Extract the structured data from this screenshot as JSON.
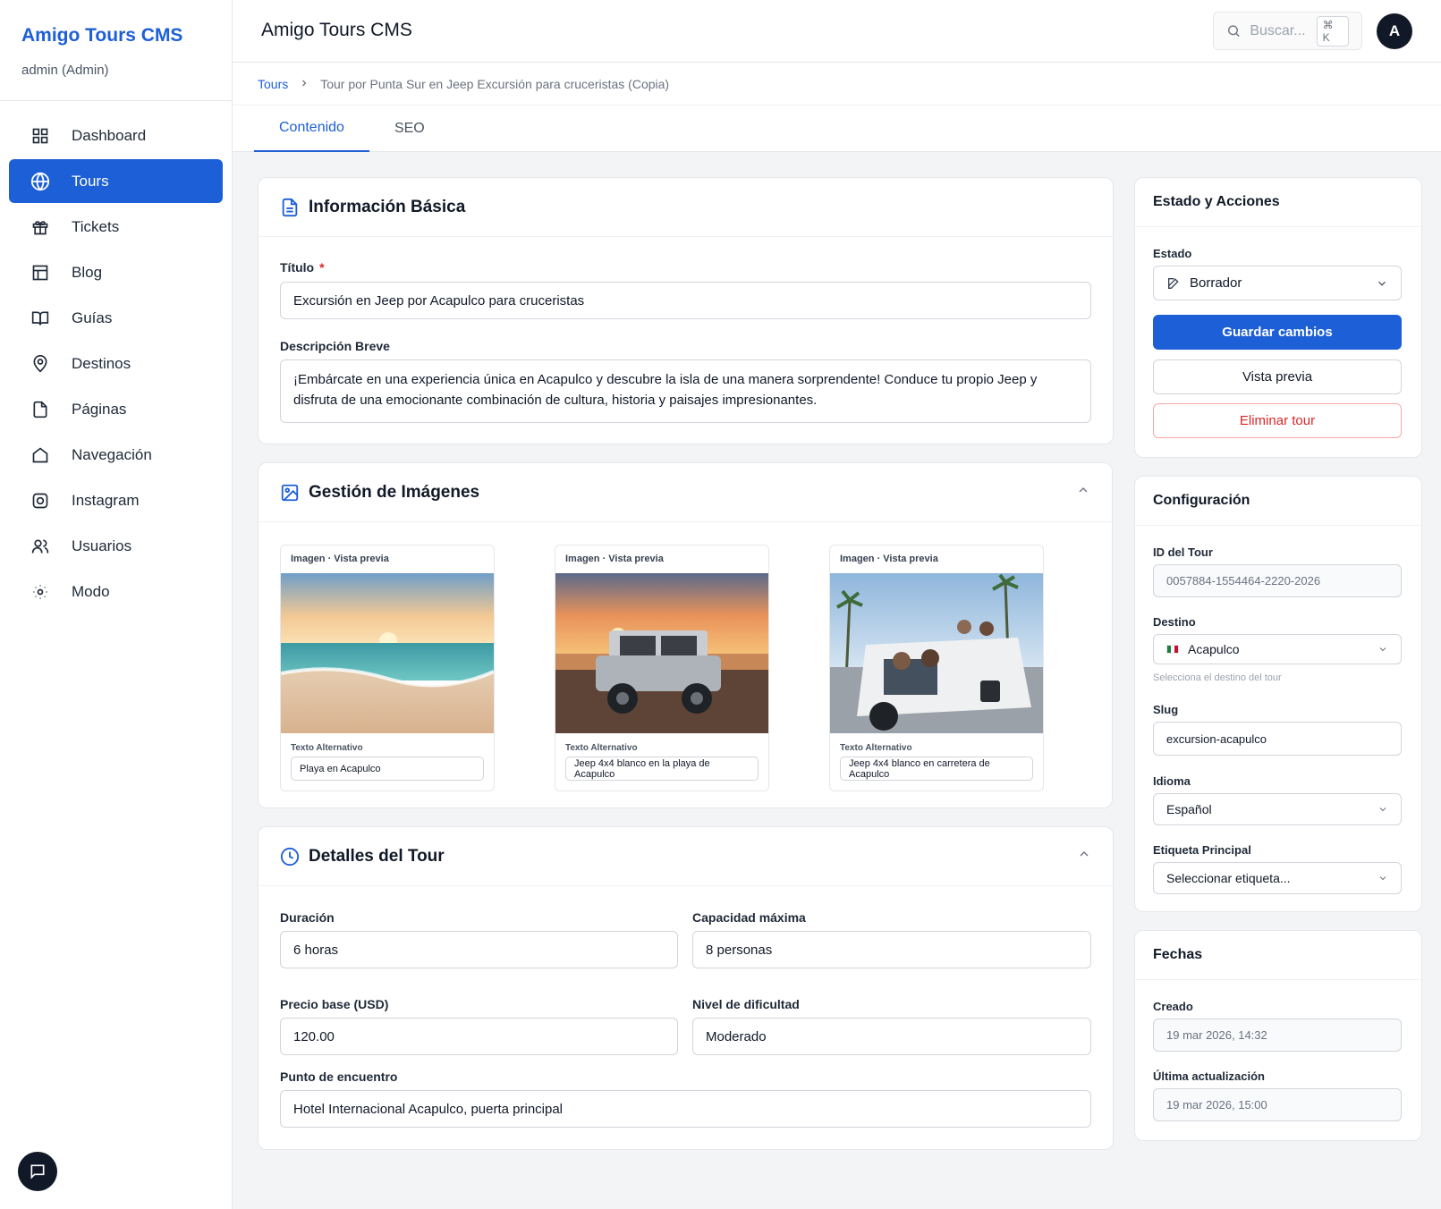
{
  "sidebar": {
    "brand": "Amigo Tours CMS",
    "user": "admin (Admin)",
    "items": [
      {
        "label": "Dashboard",
        "icon": "dashboard-icon"
      },
      {
        "label": "Tours",
        "icon": "globe-icon",
        "active": true
      },
      {
        "label": "Tickets",
        "icon": "gift-icon"
      },
      {
        "label": "Blog",
        "icon": "layout-icon"
      },
      {
        "label": "Guías",
        "icon": "book-icon"
      },
      {
        "label": "Destinos",
        "icon": "map-pin-icon"
      },
      {
        "label": "Páginas",
        "icon": "file-icon"
      },
      {
        "label": "Navegación",
        "icon": "home-icon"
      },
      {
        "label": "Instagram",
        "icon": "instagram-icon"
      },
      {
        "label": "Usuarios",
        "icon": "users-icon"
      },
      {
        "label": "Modo",
        "icon": "sun-icon"
      }
    ]
  },
  "header": {
    "title": "Amigo Tours CMS",
    "search_placeholder": "Buscar...",
    "shortcut": "⌘ K",
    "avatar_initial": "A"
  },
  "breadcrumb": {
    "root": "Tours",
    "current": "Tour por Punta Sur en Jeep Excursión para cruceristas (Copia)"
  },
  "tabs": [
    {
      "label": "Contenido",
      "active": true
    },
    {
      "label": "SEO",
      "active": false
    }
  ],
  "basic_info": {
    "title": "Información Básica",
    "title_label": "Título",
    "required_mark": "*",
    "title_value": "Excursión en Jeep por Acapulco para cruceristas",
    "desc_label": "Descripción Breve",
    "desc_value": "¡Embárcate en una experiencia única en Acapulco y descubre la isla de una manera sorprendente! Conduce tu propio Jeep y disfruta de una emocionante combinación de cultura, historia y paisajes impresionantes."
  },
  "images": {
    "title": "Gestión de Imágenes",
    "items": [
      {
        "caption": "Imagen · Vista previa",
        "alt_label": "Texto Alternativo",
        "alt": "Playa en Acapulco"
      },
      {
        "caption": "Imagen · Vista previa",
        "alt_label": "Texto Alternativo",
        "alt": "Jeep 4x4 blanco en la playa de Acapulco"
      },
      {
        "caption": "Imagen · Vista previa",
        "alt_label": "Texto Alternativo",
        "alt": "Jeep 4x4 blanco en carretera de Acapulco"
      }
    ]
  },
  "details": {
    "title": "Detalles del Tour",
    "duration_label": "Duración",
    "duration": "6 horas",
    "capacity_label": "Capacidad máxima",
    "capacity": "8 personas",
    "price_label": "Precio base (USD)",
    "price": "120.00",
    "difficulty_label": "Nivel de dificultad",
    "difficulty": "Moderado",
    "meeting_label": "Punto de encuentro",
    "meeting": "Hotel Internacional Acapulco, puerta principal"
  },
  "status_card": {
    "title": "Estado y Acciones",
    "status_label": "Estado",
    "status": "Borrador",
    "save": "Guardar cambios",
    "preview": "Vista previa",
    "delete": "Eliminar tour"
  },
  "config": {
    "title": "Configuración",
    "id_label": "ID del Tour",
    "id": "0057884-1554464-2220-2026",
    "dest_label": "Destino",
    "dest": "Acapulco",
    "dest_hint": "Selecciona el destino del tour",
    "slug_label": "Slug",
    "slug": "excursion-acapulco",
    "lang_label": "Idioma",
    "lang": "Español",
    "tag_label": "Etiqueta Principal",
    "tag": "Seleccionar etiqueta..."
  },
  "dates": {
    "title": "Fechas",
    "created_label": "Creado",
    "created": "19 mar 2026, 14:32",
    "updated_label": "Última actualización",
    "updated": "19 mar 2026, 15:00"
  },
  "colors": {
    "accent": "#1d5fd6",
    "danger": "#dc2626",
    "dark": "#111827"
  }
}
